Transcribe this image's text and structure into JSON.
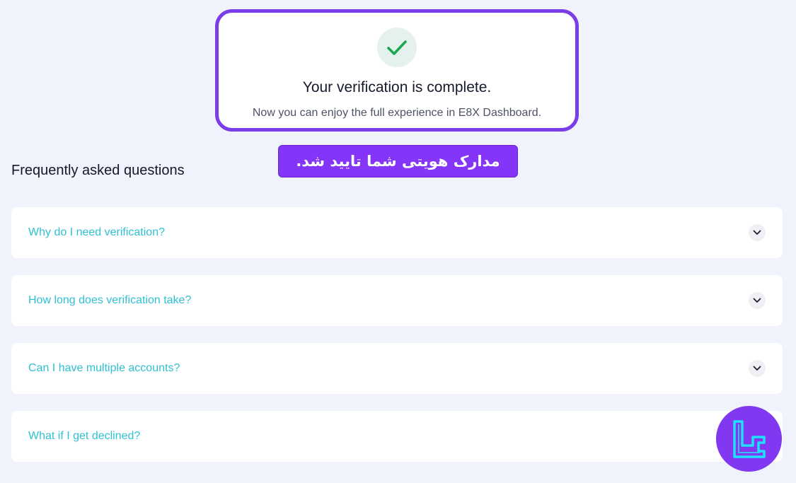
{
  "verification": {
    "title": "Your verification is complete.",
    "subtitle": "Now you can enjoy the full experience in E8X Dashboard.",
    "icon": "checkmark-icon",
    "border_color": "#7a3de8"
  },
  "annotation": {
    "label": "مدارک هویتی شما تایید شد.",
    "color": "#8435f8"
  },
  "faq": {
    "heading": "Frequently asked questions",
    "items": [
      {
        "question": "Why do I need verification?"
      },
      {
        "question": "How long does verification take?"
      },
      {
        "question": "Can I have multiple accounts?"
      },
      {
        "question": "What if I get declined?"
      }
    ],
    "question_color": "#2fc1d3"
  },
  "watermark": {
    "icon": "tc-logo-icon",
    "color": "#8138f0"
  }
}
